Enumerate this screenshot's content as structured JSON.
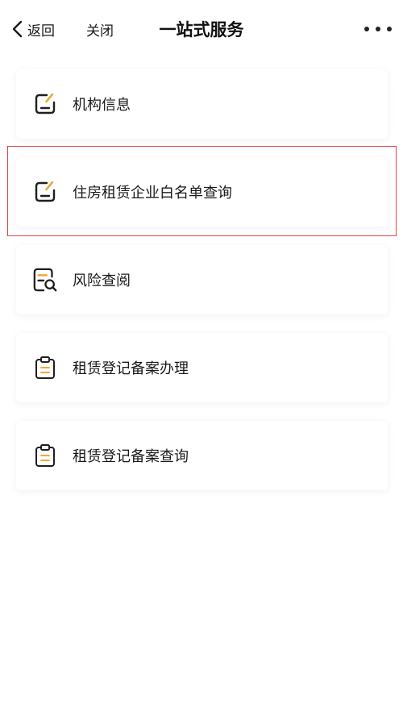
{
  "nav": {
    "back_label": "返回",
    "close_label": "关闭",
    "title": "一站式服务"
  },
  "menu": {
    "items": [
      {
        "label": "机构信息",
        "icon": "edit-square-icon"
      },
      {
        "label": "住房租赁企业白名单查询",
        "icon": "edit-square-icon"
      },
      {
        "label": "风险查阅",
        "icon": "document-search-icon"
      },
      {
        "label": "租赁登记备案办理",
        "icon": "clipboard-icon"
      },
      {
        "label": "租赁登记备案查询",
        "icon": "clipboard-icon"
      }
    ]
  },
  "colors": {
    "accent": "#f0a93b",
    "highlight_border": "#e04545",
    "icon_stroke": "#1f1f1f"
  }
}
